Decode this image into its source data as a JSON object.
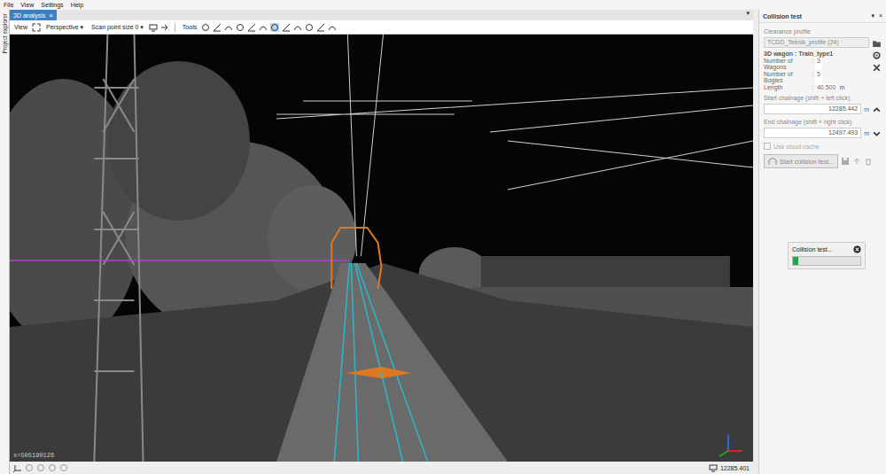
{
  "menu": [
    "File",
    "View",
    "Settings",
    "Help"
  ],
  "side_strip": {
    "label": "Project explorer"
  },
  "tabs": [
    {
      "label": "3D analysis",
      "selected": true,
      "close": "×"
    }
  ],
  "tabbar_menu": "▾",
  "toolbar": {
    "view_label": "View",
    "projection": "Perspective",
    "projection_arrow": "▾",
    "point_size": "Scan point size 0",
    "point_size_arrow": "▾",
    "tools_label": "Tools"
  },
  "viewport": {
    "coordinate": "x=505190126"
  },
  "status_bar": {
    "chainage": "12285.401"
  },
  "panel": {
    "title": "Collision test",
    "header_icons": [
      "▾",
      "×"
    ],
    "clearance_label": "Clearance profile",
    "clearance_value": "TCDD_Teknik_profile (24)",
    "clearance_disabled": true,
    "wagon": {
      "title": "3D wagon : Train_type1",
      "rows": [
        {
          "label": "Number of Wagons",
          "sep": ":",
          "value": "3",
          "unit": ""
        },
        {
          "label": "Number of Bogies",
          "sep": ":",
          "value": "5",
          "unit": ""
        },
        {
          "label": "Length",
          "sep": ":",
          "value": "40.500",
          "unit": "m"
        }
      ]
    },
    "start": {
      "label": "Start chainage (shift + left click)",
      "value": "12285.442",
      "unit": "m"
    },
    "end": {
      "label": "End chainage (shift + right click)",
      "value": "12497.493",
      "unit": "m"
    },
    "cache": {
      "label": "Use cloud cache",
      "checked": false,
      "disabled": true
    },
    "start_button": {
      "label": "Start collision test...",
      "disabled": true
    }
  },
  "progress": {
    "title": "Collision test...",
    "level": 0.08
  }
}
